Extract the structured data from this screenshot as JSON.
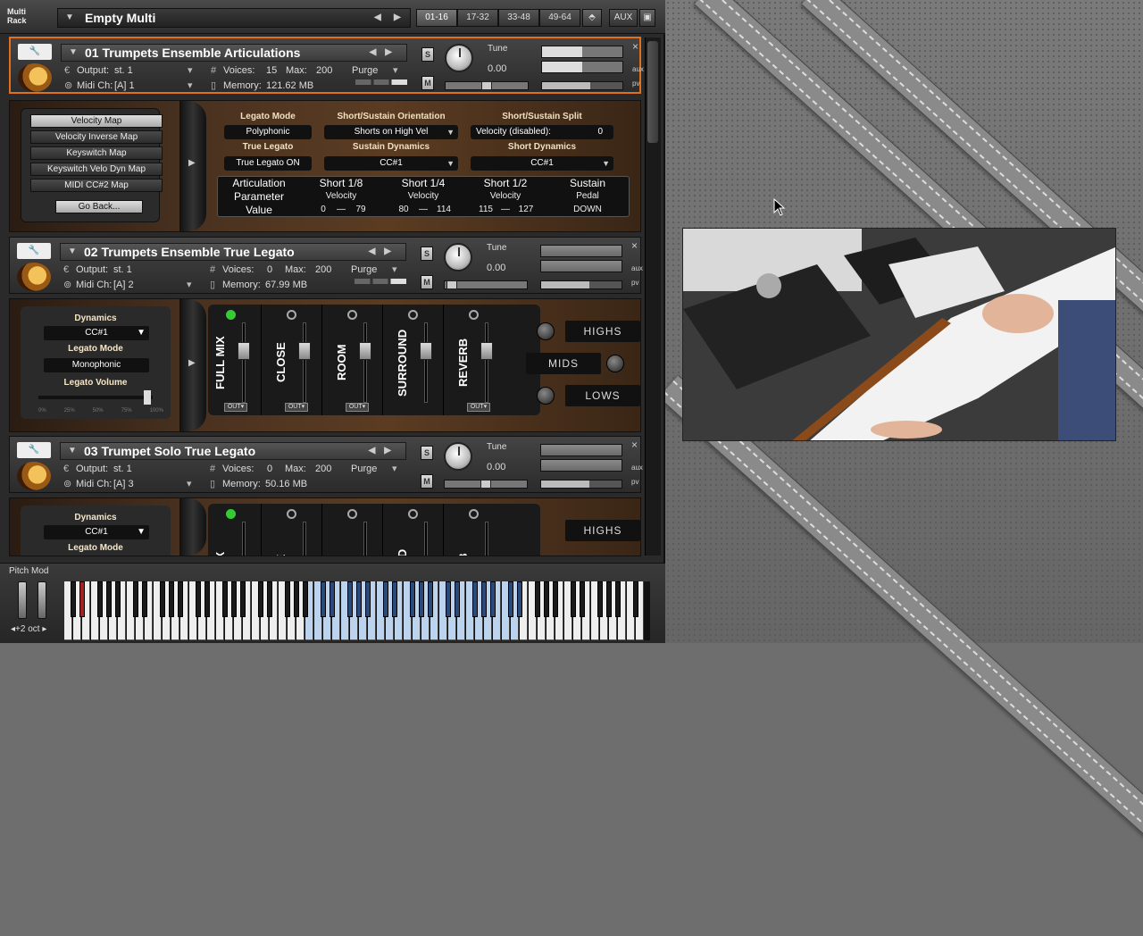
{
  "topbar": {
    "rack_label_line1": "Multi",
    "rack_label_line2": "Rack",
    "multi_name": "Empty Multi",
    "pages": [
      "01-16",
      "17-32",
      "33-48",
      "49-64"
    ],
    "aux_label": "AUX"
  },
  "instruments": [
    {
      "name": "01 Trumpets Ensemble Articulations",
      "output_label": "Output:",
      "output_value": "st. 1",
      "voices_label": "Voices:",
      "voices_value": "15",
      "max_label": "Max:",
      "max_value": "200",
      "purge_label": "Purge",
      "midi_label": "Midi Ch:",
      "midi_value": "[A]  1",
      "memory_label": "Memory:",
      "memory_value": "121.62 MB",
      "tune_label": "Tune",
      "tune_value": "0.00",
      "solo_label": "S",
      "mute_label": "M",
      "side_labels": [
        "aux",
        "pv"
      ],
      "close_label": "×",
      "selected": true
    },
    {
      "name": "02 Trumpets Ensemble True Legato",
      "output_label": "Output:",
      "output_value": "st. 1",
      "voices_label": "Voices:",
      "voices_value": "0",
      "max_label": "Max:",
      "max_value": "200",
      "purge_label": "Purge",
      "midi_label": "Midi Ch:",
      "midi_value": "[A]  2",
      "memory_label": "Memory:",
      "memory_value": "67.99 MB",
      "tune_label": "Tune",
      "tune_value": "0.00",
      "solo_label": "S",
      "mute_label": "M",
      "side_labels": [
        "aux",
        "pv"
      ],
      "close_label": "×",
      "selected": false
    },
    {
      "name": "03 Trumpet Solo True Legato",
      "output_label": "Output:",
      "output_value": "st. 1",
      "voices_label": "Voices:",
      "voices_value": "0",
      "max_label": "Max:",
      "max_value": "200",
      "purge_label": "Purge",
      "midi_label": "Midi Ch:",
      "midi_value": "[A]  3",
      "memory_label": "Memory:",
      "memory_value": "50.16 MB",
      "tune_label": "Tune",
      "tune_value": "0.00",
      "solo_label": "S",
      "mute_label": "M",
      "side_labels": [
        "aux",
        "pv"
      ],
      "close_label": "×",
      "selected": false
    }
  ],
  "panel1": {
    "map_buttons": [
      "Velocity Map",
      "Velocity Inverse Map",
      "Keyswitch Map",
      "Keyswitch Velo Dyn Map",
      "MIDI CC#2 Map"
    ],
    "back_button": "Go Back...",
    "legato_mode_label": "Legato Mode",
    "legato_mode_value": "Polyphonic",
    "orientation_label": "Short/Sustain Orientation",
    "orientation_value": "Shorts on High Vel",
    "split_label": "Short/Sustain Split",
    "split_value_label": "Velocity (disabled):",
    "split_value": "0",
    "true_legato_label": "True Legato",
    "true_legato_value": "True Legato ON",
    "sustain_dyn_label": "Sustain Dynamics",
    "sustain_dyn_value": "CC#1",
    "short_dyn_label": "Short Dynamics",
    "short_dyn_value": "CC#1",
    "table": {
      "row_labels": [
        "Articulation",
        "Parameter",
        "Value"
      ],
      "columns": [
        {
          "name": "Short 1/8",
          "param": "Velocity",
          "lo": "0",
          "hi": "79"
        },
        {
          "name": "Short 1/4",
          "param": "Velocity",
          "lo": "80",
          "hi": "114"
        },
        {
          "name": "Short 1/2",
          "param": "Velocity",
          "lo": "115",
          "hi": "127"
        },
        {
          "name": "Sustain",
          "param": "Pedal",
          "value": "DOWN"
        }
      ],
      "dash": "—"
    }
  },
  "panel2": {
    "dynamics_label": "Dynamics",
    "dynamics_value": "CC#1",
    "legato_mode_label": "Legato Mode",
    "legato_mode_value": "Monophonic",
    "legato_volume_label": "Legato Volume",
    "volume_ticks": [
      "0%",
      "25%",
      "50%",
      "75%",
      "100%"
    ],
    "mixer_channels": [
      "FULL MIX",
      "CLOSE",
      "ROOM",
      "SURROUND",
      "REVERB"
    ],
    "out_label": "OUT▾",
    "eq_bands": [
      "HIGHS",
      "MIDS",
      "LOWS"
    ]
  },
  "panel3": {
    "dynamics_label": "Dynamics",
    "dynamics_value": "CC#1",
    "legato_mode_label": "Legato Mode",
    "mixer_channels_partial": [
      "MIX",
      "SE",
      "M",
      "UND",
      "RB"
    ],
    "eq_bands": [
      "HIGHS"
    ]
  },
  "keyboard": {
    "pitch_label": "Pitch Mod",
    "octave_label": "◂+2 oct ▸"
  },
  "colors": {
    "selected_border": "#e07020",
    "highlight_key": "#bcd3ee"
  }
}
